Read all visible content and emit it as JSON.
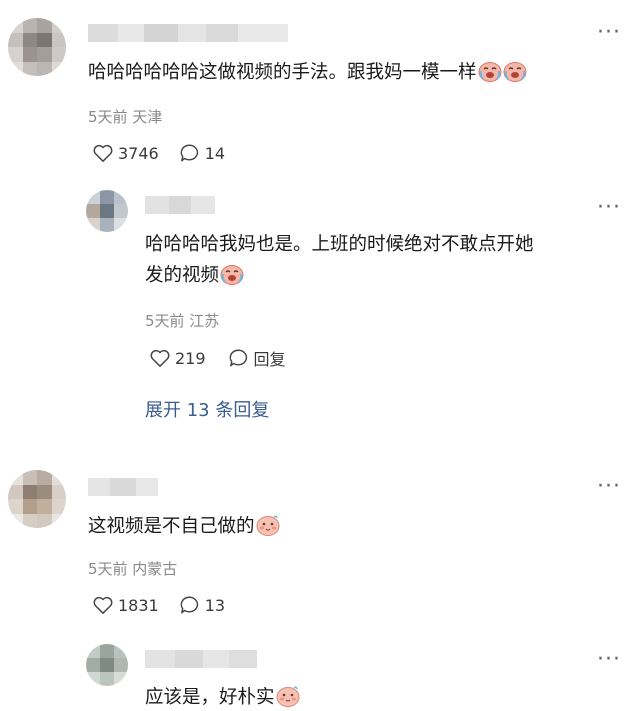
{
  "comments": [
    {
      "text": "哈哈哈哈哈哈这做视频的手法。跟我妈一模一样",
      "meta": "5天前 天津",
      "likes": "3746",
      "replies": "14",
      "emojis": [
        "laugh-cry-emoji",
        "laugh-cry-emoji"
      ]
    },
    {
      "text": "这视频是不自己做的",
      "meta": "5天前 内蒙古",
      "likes": "1831",
      "replies": "13",
      "emojis": [
        "blush-emoji"
      ]
    }
  ],
  "replies": [
    {
      "text_line1": "哈哈哈哈我妈也是。上班的时候绝对不敢点开她",
      "text_line2": "发的视频",
      "meta": "5天前 江苏",
      "likes": "219",
      "reply_label": "回复",
      "emojis": [
        "laugh-cry-emoji"
      ]
    },
    {
      "text": "应该是，好朴实",
      "emojis": [
        "blush-emoji"
      ]
    }
  ],
  "expand_label": "展开 13 条回复",
  "more_icon": "more-dots-icon",
  "colors": {
    "link": "#3b5c8f",
    "meta": "#8a8a8a",
    "text": "#1a1a1a"
  }
}
